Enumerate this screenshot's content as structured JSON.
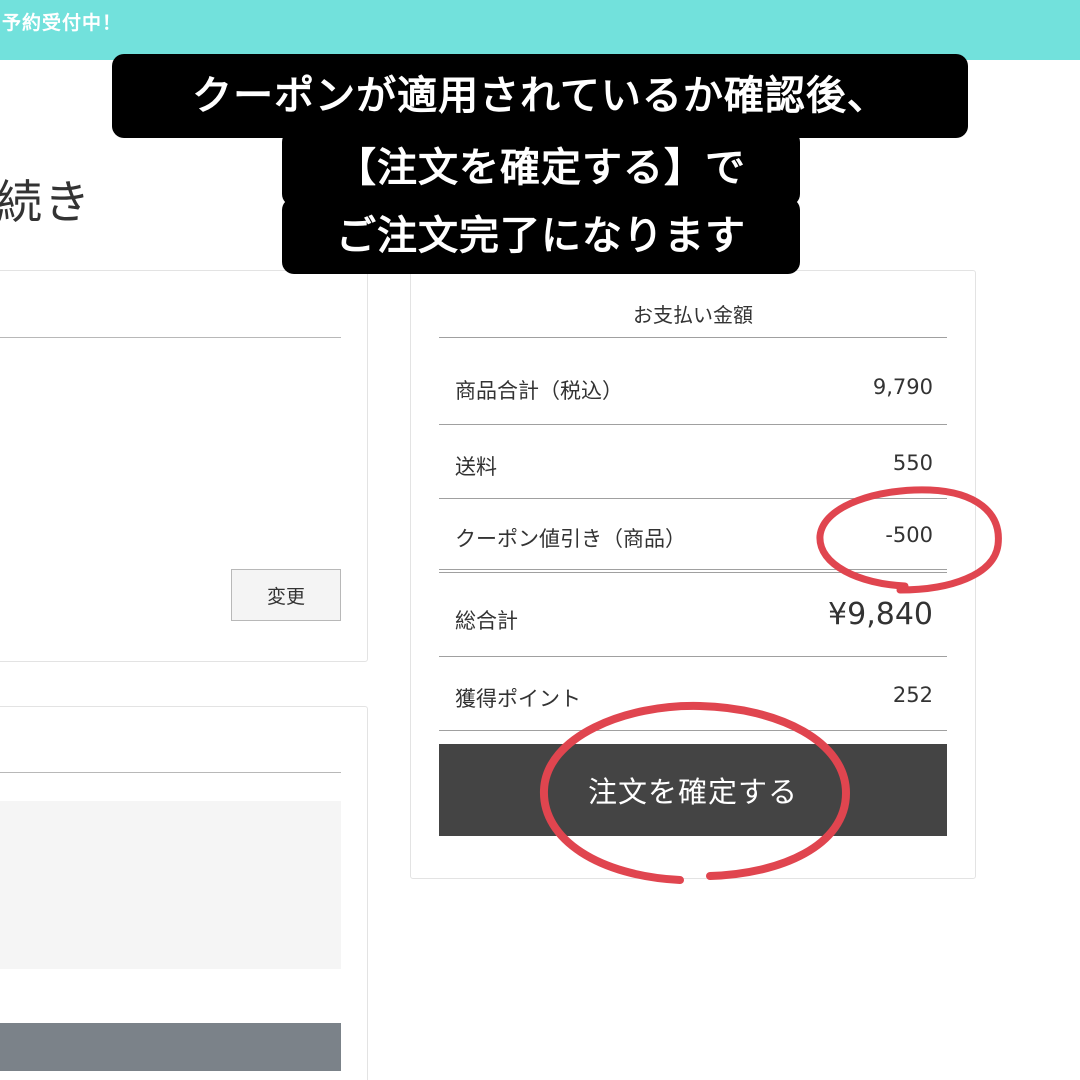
{
  "banner": {
    "text": "予約受付中！"
  },
  "page": {
    "heading": "続き"
  },
  "left": {
    "change_label": "変更"
  },
  "summary": {
    "title": "お支払い金額",
    "rows": [
      {
        "label": "商品合計（税込）",
        "value": "9,790"
      },
      {
        "label": "送料",
        "value": "550"
      },
      {
        "label": "クーポン値引き（商品）",
        "value": "-500"
      },
      {
        "label": "総合計",
        "value": "¥9,840"
      },
      {
        "label": "獲得ポイント",
        "value": "252"
      }
    ],
    "confirm_label": "注文を確定する"
  },
  "callout": {
    "line1": "クーポンが適用されているか確認後、",
    "line2": "【注文を確定する】で",
    "line3": "ご注文完了になります"
  },
  "colors": {
    "banner": "#72e1dc",
    "confirm_button": "#444444",
    "highlight_circle": "#e0454f",
    "callout_bg": "#000000"
  }
}
